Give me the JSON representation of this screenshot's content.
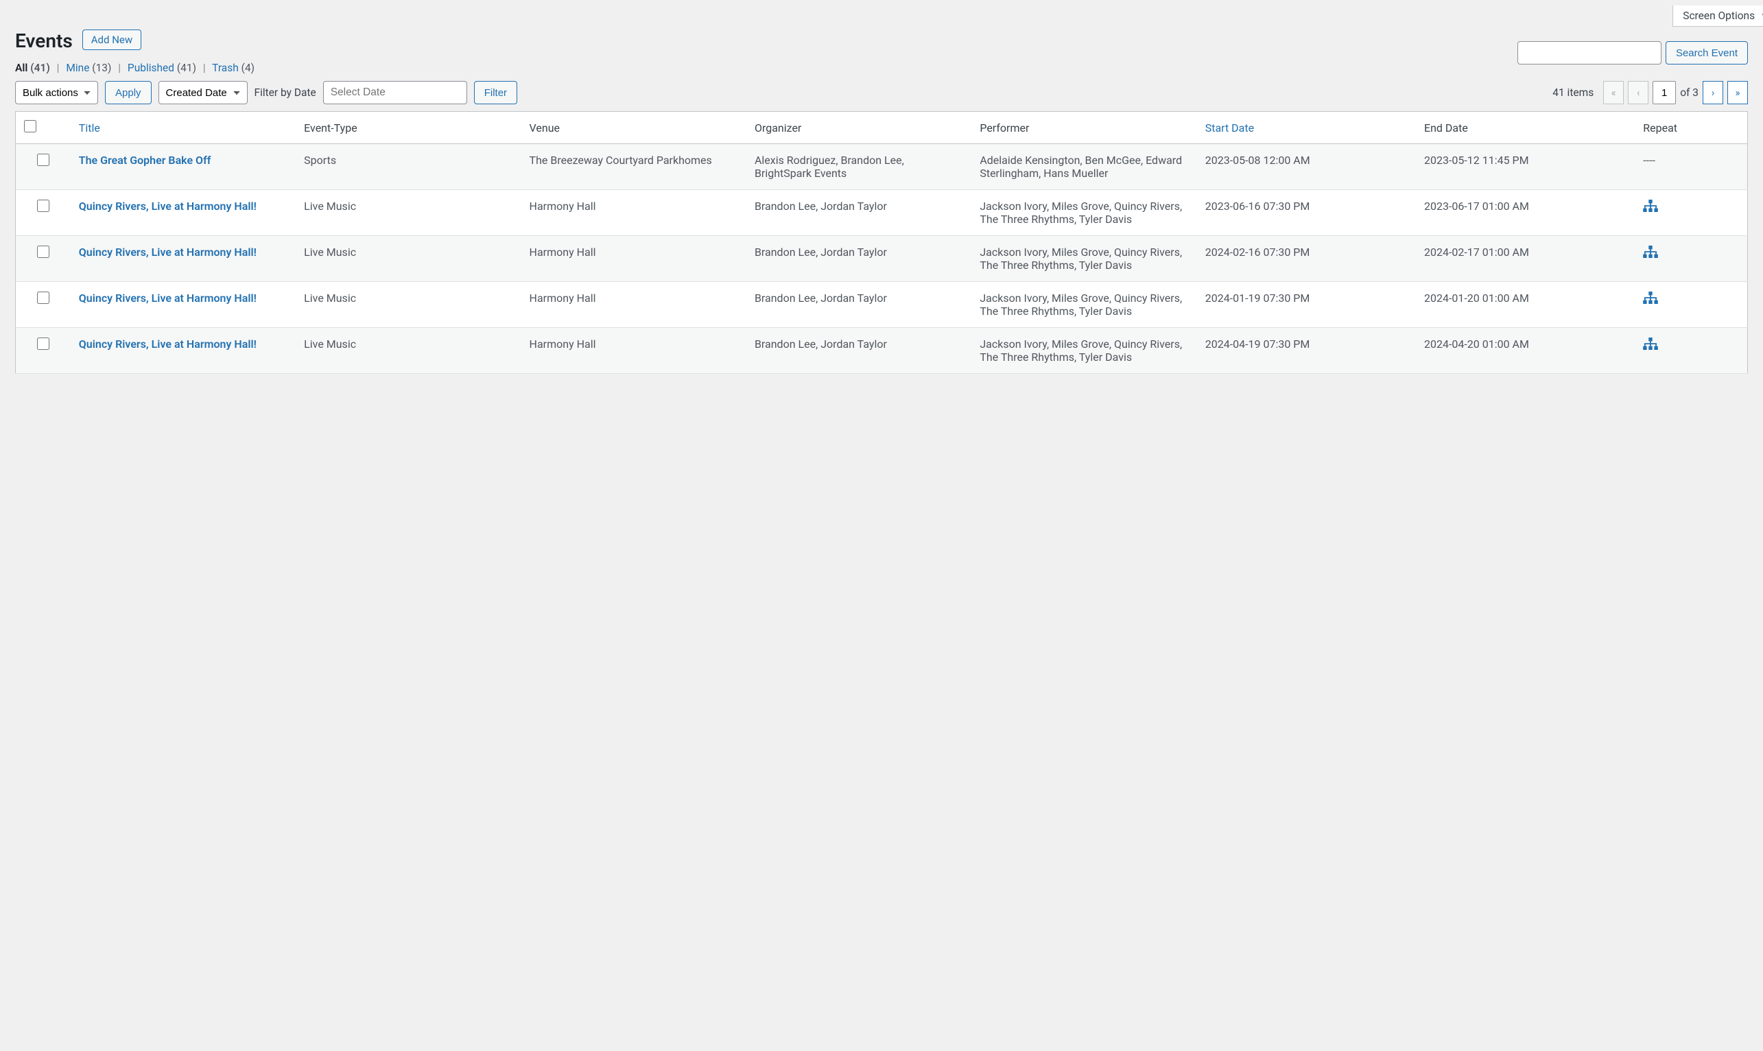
{
  "screen_options": "Screen Options",
  "page_title": "Events",
  "add_new": "Add New",
  "filters": {
    "all": {
      "label": "All",
      "count": "(41)"
    },
    "mine": {
      "label": "Mine",
      "count": "(13)"
    },
    "published": {
      "label": "Published",
      "count": "(41)"
    },
    "trash": {
      "label": "Trash",
      "count": "(4)"
    }
  },
  "search": {
    "placeholder": "",
    "button": "Search Event"
  },
  "bulk": {
    "label": "Bulk actions",
    "apply": "Apply"
  },
  "date_filter": {
    "sort": "Created Date",
    "label": "Filter by Date",
    "placeholder": "Select Date",
    "button": "Filter"
  },
  "pagination": {
    "items": "41 items",
    "current": "1",
    "of": "of 3"
  },
  "columns": {
    "title": "Title",
    "event_type": "Event-Type",
    "venue": "Venue",
    "organizer": "Organizer",
    "performer": "Performer",
    "start": "Start Date",
    "end": "End Date",
    "repeat": "Repeat"
  },
  "rows": [
    {
      "title": "The Great Gopher Bake Off",
      "event_type": "Sports",
      "venue": "The Breezeway Courtyard Parkhomes",
      "organizer": "Alexis Rodriguez, Brandon Lee, BrightSpark Events",
      "performer": "Adelaide Kensington, Ben McGee, Edward Sterlingham, Hans Mueller",
      "start": "2023-05-08 12:00 AM",
      "end": "2023-05-12 11:45 PM",
      "repeat": "----",
      "has_repeat_icon": false
    },
    {
      "title": "Quincy Rivers, Live at Harmony Hall!",
      "event_type": "Live Music",
      "venue": "Harmony Hall",
      "organizer": "Brandon Lee, Jordan Taylor",
      "performer": "Jackson Ivory, Miles Grove, Quincy Rivers, The Three Rhythms, Tyler Davis",
      "start": "2023-06-16 07:30 PM",
      "end": "2023-06-17 01:00 AM",
      "repeat": "",
      "has_repeat_icon": true
    },
    {
      "title": "Quincy Rivers, Live at Harmony Hall!",
      "event_type": "Live Music",
      "venue": "Harmony Hall",
      "organizer": "Brandon Lee, Jordan Taylor",
      "performer": "Jackson Ivory, Miles Grove, Quincy Rivers, The Three Rhythms, Tyler Davis",
      "start": "2024-02-16 07:30 PM",
      "end": "2024-02-17 01:00 AM",
      "repeat": "",
      "has_repeat_icon": true
    },
    {
      "title": "Quincy Rivers, Live at Harmony Hall!",
      "event_type": "Live Music",
      "venue": "Harmony Hall",
      "organizer": "Brandon Lee, Jordan Taylor",
      "performer": "Jackson Ivory, Miles Grove, Quincy Rivers, The Three Rhythms, Tyler Davis",
      "start": "2024-01-19 07:30 PM",
      "end": "2024-01-20 01:00 AM",
      "repeat": "",
      "has_repeat_icon": true
    },
    {
      "title": "Quincy Rivers, Live at Harmony Hall!",
      "event_type": "Live Music",
      "venue": "Harmony Hall",
      "organizer": "Brandon Lee, Jordan Taylor",
      "performer": "Jackson Ivory, Miles Grove, Quincy Rivers, The Three Rhythms, Tyler Davis",
      "start": "2024-04-19 07:30 PM",
      "end": "2024-04-20 01:00 AM",
      "repeat": "",
      "has_repeat_icon": true
    }
  ]
}
